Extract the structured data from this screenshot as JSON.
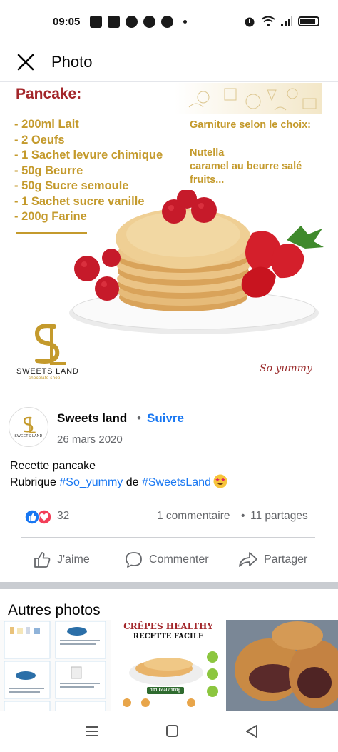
{
  "status_bar": {
    "time": "09:05"
  },
  "header": {
    "title": "Photo"
  },
  "photo": {
    "recipe_title": "Pancake:",
    "ingredients": [
      "- 200ml Lait",
      "- 2 Oeufs",
      "- 1 Sachet levure chimique",
      "- 50g Beurre",
      "- 50g Sucre semoule",
      "- 1 Sachet sucre vanille",
      "- 200g Farine"
    ],
    "garniture_title": "Garniture selon le choix:",
    "garniture_items": [
      "Nutella",
      "caramel au beurre salé",
      "fruits..."
    ],
    "brand_name": "SWEETS LAND",
    "brand_sub": "chocolate shop",
    "slogan": "So yummy"
  },
  "post": {
    "page_name": "Sweets land",
    "separator": "•",
    "follow_label": "Suivre",
    "date": "26 mars 2020",
    "avatar_text": "SWEETS LAND",
    "caption_line1": "Recette pancake",
    "caption_line2_prefix": "Rubrique ",
    "hashtag1": "#So_yummy",
    "caption_mid": " de ",
    "hashtag2": "#SweetsLand"
  },
  "reactions": {
    "count": "32",
    "comments": "1 commentaire",
    "separator": "•",
    "shares": "11 partages"
  },
  "actions": {
    "like": "J'aime",
    "comment": "Commenter",
    "share": "Partager"
  },
  "other_photos": {
    "title": "Autres photos",
    "thumb2_line1": "CRÊPES HEALTHY",
    "thumb2_line2": "RECETTE FACILE",
    "thumb2_badge": "101 kcal / 100g"
  },
  "icons": {
    "close": "close-icon",
    "like": "thumbs-up-icon",
    "comment": "speech-bubble-icon",
    "share": "share-arrow-icon",
    "nav_recent": "menu-lines-icon",
    "nav_home": "square-icon",
    "nav_back": "triangle-back-icon"
  },
  "colors": {
    "facebook_blue": "#1877f2",
    "secondary_text": "#65676b",
    "recipe_red": "#a3262a",
    "recipe_gold": "#c49a2c"
  }
}
